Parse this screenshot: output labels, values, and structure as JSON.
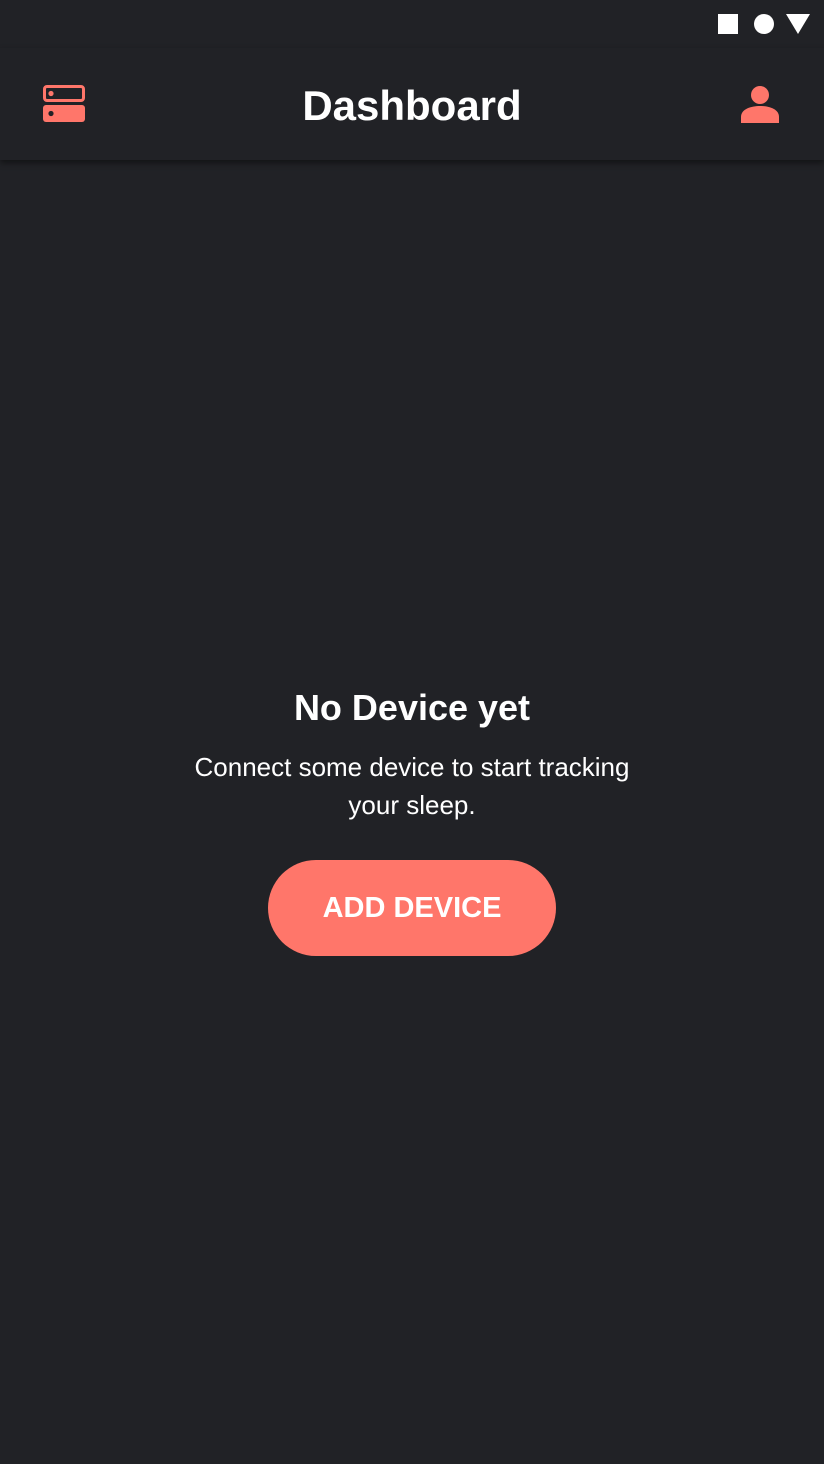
{
  "status_bar": {
    "icons": [
      "stop-square-icon",
      "record-circle-icon",
      "signal-triangle-icon"
    ]
  },
  "app_bar": {
    "title": "Dashboard",
    "left_icon": "devices-list-icon",
    "right_icon": "person-icon"
  },
  "empty_state": {
    "title": "No Device yet",
    "description": "Connect some device to start tracking your sleep.",
    "button_label": "ADD DEVICE"
  },
  "colors": {
    "background": "#212226",
    "accent": "#ff766a",
    "text": "#ffffff"
  }
}
